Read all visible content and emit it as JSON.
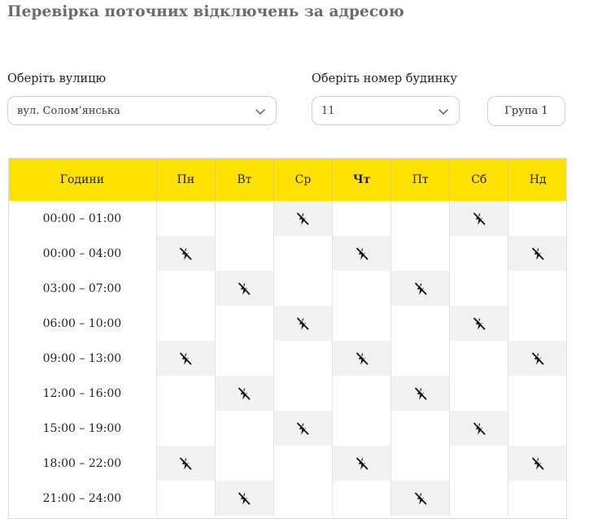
{
  "title": "Перевірка поточних відключень за адресою",
  "street": {
    "label": "Оберіть вулицю",
    "value": "вул. Солом’янська"
  },
  "house": {
    "label": "Оберіть номер будинку",
    "value": "11"
  },
  "group_button": "Група 1",
  "table": {
    "hours_header": "Години",
    "days": [
      "Пн",
      "Вт",
      "Ср",
      "Чт",
      "Пт",
      "Сб",
      "Нд"
    ],
    "today_index": 3,
    "rows": [
      {
        "hours": "00:00 – 01:00",
        "off": [
          false,
          false,
          true,
          false,
          false,
          true,
          false
        ]
      },
      {
        "hours": "00:00 – 04:00",
        "off": [
          true,
          false,
          false,
          true,
          false,
          false,
          true
        ]
      },
      {
        "hours": "03:00 – 07:00",
        "off": [
          false,
          true,
          false,
          false,
          true,
          false,
          false
        ]
      },
      {
        "hours": "06:00 – 10:00",
        "off": [
          false,
          false,
          true,
          false,
          false,
          true,
          false
        ]
      },
      {
        "hours": "09:00 – 13:00",
        "off": [
          true,
          false,
          false,
          true,
          false,
          false,
          true
        ]
      },
      {
        "hours": "12:00 – 16:00",
        "off": [
          false,
          true,
          false,
          false,
          true,
          false,
          false
        ]
      },
      {
        "hours": "15:00 – 19:00",
        "off": [
          false,
          false,
          true,
          false,
          false,
          true,
          false
        ]
      },
      {
        "hours": "18:00 – 22:00",
        "off": [
          true,
          false,
          false,
          true,
          false,
          false,
          true
        ]
      },
      {
        "hours": "21:00 – 24:00",
        "off": [
          false,
          true,
          false,
          false,
          true,
          false,
          false
        ]
      }
    ],
    "off_icon": "power-off-icon",
    "header_color": "#ffe200",
    "off_cell_color": "#f2f2f2"
  }
}
